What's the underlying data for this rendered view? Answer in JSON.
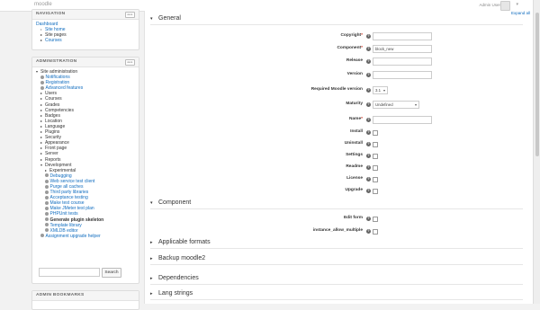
{
  "header": {
    "brand": "moodle",
    "user": "Admin User",
    "caret": "▾"
  },
  "navigation": {
    "title": "NAVIGATION",
    "items": [
      {
        "label": "Dashboard",
        "indent": 0,
        "link": true
      },
      {
        "label": "Site home",
        "indent": 1,
        "link": true,
        "bullet": "•"
      },
      {
        "label": "Site pages",
        "indent": 1,
        "link": false,
        "tri": "▸"
      },
      {
        "label": "Courses",
        "indent": 1,
        "link": true,
        "tri": "▸"
      }
    ]
  },
  "administration": {
    "title": "ADMINISTRATION",
    "items": [
      {
        "label": "Site administration",
        "indent": 0,
        "tri": "▾"
      },
      {
        "label": "Notifications",
        "indent": 1,
        "gear": true,
        "link": true
      },
      {
        "label": "Registration",
        "indent": 1,
        "gear": true,
        "link": true
      },
      {
        "label": "Advanced features",
        "indent": 1,
        "gear": true,
        "link": true
      },
      {
        "label": "Users",
        "indent": 1,
        "tri": "▸"
      },
      {
        "label": "Courses",
        "indent": 1,
        "tri": "▸"
      },
      {
        "label": "Grades",
        "indent": 1,
        "tri": "▸"
      },
      {
        "label": "Competencies",
        "indent": 1,
        "tri": "▸"
      },
      {
        "label": "Badges",
        "indent": 1,
        "tri": "▸"
      },
      {
        "label": "Location",
        "indent": 1,
        "tri": "▸"
      },
      {
        "label": "Language",
        "indent": 1,
        "tri": "▸"
      },
      {
        "label": "Plugins",
        "indent": 1,
        "tri": "▸"
      },
      {
        "label": "Security",
        "indent": 1,
        "tri": "▸"
      },
      {
        "label": "Appearance",
        "indent": 1,
        "tri": "▸"
      },
      {
        "label": "Front page",
        "indent": 1,
        "tri": "▸"
      },
      {
        "label": "Server",
        "indent": 1,
        "tri": "▸"
      },
      {
        "label": "Reports",
        "indent": 1,
        "tri": "▸"
      },
      {
        "label": "Development",
        "indent": 1,
        "tri": "▾"
      },
      {
        "label": "Experimental",
        "indent": 2,
        "tri": "▸"
      },
      {
        "label": "Debugging",
        "indent": 2,
        "gear": true,
        "link": true
      },
      {
        "label": "Web service test client",
        "indent": 2,
        "gear": true,
        "link": true
      },
      {
        "label": "Purge all caches",
        "indent": 2,
        "gear": true,
        "link": true
      },
      {
        "label": "Third party libraries",
        "indent": 2,
        "gear": true,
        "link": true
      },
      {
        "label": "Acceptance testing",
        "indent": 2,
        "gear": true,
        "link": true
      },
      {
        "label": "Make test course",
        "indent": 2,
        "gear": true,
        "link": true
      },
      {
        "label": "Make JMeter test plan",
        "indent": 2,
        "gear": true,
        "link": true
      },
      {
        "label": "PHPUnit tests",
        "indent": 2,
        "gear": true,
        "link": true
      },
      {
        "label": "Generate plugin skeleton",
        "indent": 2,
        "gear": true,
        "bold": true
      },
      {
        "label": "Template library",
        "indent": 2,
        "gear": true,
        "link": true
      },
      {
        "label": "XMLDB editor",
        "indent": 2,
        "gear": true,
        "link": true
      },
      {
        "label": "Assignment upgrade helper",
        "indent": 1,
        "gear": true,
        "link": true
      }
    ],
    "search_button": "Search"
  },
  "bookmarks": {
    "title": "ADMIN BOOKMARKS"
  },
  "main": {
    "expand_all": "Expand all",
    "general_section": "General",
    "component_section": "Component",
    "general_fields": [
      {
        "label": "Copyright",
        "required": true,
        "type": "text",
        "value": ""
      },
      {
        "label": "Component",
        "required": true,
        "type": "text",
        "value": "block_new"
      },
      {
        "label": "Release",
        "required": false,
        "type": "text",
        "value": ""
      },
      {
        "label": "Version",
        "required": false,
        "type": "text",
        "value": ""
      },
      {
        "label": "Required Moodle version",
        "required": false,
        "type": "select",
        "value": "3.1"
      },
      {
        "label": "Maturity",
        "required": false,
        "type": "select",
        "value": "Undefined"
      },
      {
        "label": "Name",
        "required": true,
        "type": "text",
        "value": ""
      },
      {
        "label": "Install",
        "required": false,
        "type": "checkbox"
      },
      {
        "label": "Uninstall",
        "required": false,
        "type": "checkbox"
      },
      {
        "label": "Settings",
        "required": false,
        "type": "checkbox"
      },
      {
        "label": "Readme",
        "required": false,
        "type": "checkbox"
      },
      {
        "label": "License",
        "required": false,
        "type": "checkbox"
      },
      {
        "label": "Upgrade",
        "required": false,
        "type": "checkbox"
      }
    ],
    "component_fields": [
      {
        "label": "Edit form",
        "type": "checkbox"
      },
      {
        "label": "instance_allow_multiple",
        "type": "checkbox"
      }
    ],
    "collapsed_sections": [
      "Applicable formats",
      "Backup moodle2",
      "Dependencies",
      "Lang strings"
    ]
  }
}
